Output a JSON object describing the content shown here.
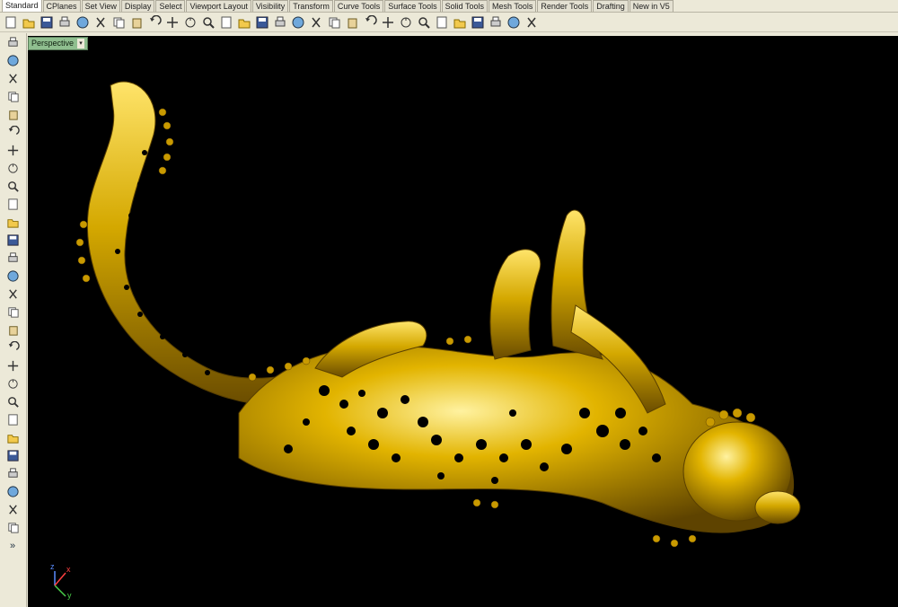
{
  "tabs": [
    "Standard",
    "CPlanes",
    "Set View",
    "Display",
    "Select",
    "Viewport Layout",
    "Visibility",
    "Transform",
    "Curve Tools",
    "Surface Tools",
    "Solid Tools",
    "Mesh Tools",
    "Render Tools",
    "Drafting",
    "New in V5"
  ],
  "active_tab": "Standard",
  "viewport": {
    "title": "Perspective",
    "dropdown_glyph": "▾"
  },
  "axis": {
    "x": "x",
    "y": "y",
    "z": "z"
  },
  "colors": {
    "gold": "#d4a800",
    "gold_light": "#ffe46a",
    "gold_dark": "#7a5a00",
    "viewport_bg": "#000000"
  },
  "toolbar_icons": [
    "new-icon",
    "open-icon",
    "save-icon",
    "print-icon",
    "import-icon",
    "cut-icon",
    "copy-icon",
    "paste-icon",
    "undo-icon",
    "pan-icon",
    "rotate-icon",
    "zoom-icon",
    "zoom-window-icon",
    "zoom-extents-icon",
    "zoom-selected-icon",
    "rotate-view-icon",
    "four-view-icon",
    "car-icon",
    "point-icon",
    "grid-icon",
    "light-icon",
    "lock-icon",
    "layer-icon",
    "color-wheel-icon",
    "material-icon",
    "sphere-icon",
    "render-icon",
    "osnap-icon",
    "gumball-icon",
    "help-icon"
  ],
  "side_icons": [
    "select-icon",
    "point-icon",
    "polyline-icon",
    "curve-icon",
    "circle-icon",
    "ellipse-icon",
    "polygon-icon",
    "rectangle-icon",
    "arc-icon",
    "fillet-icon",
    "surface-icon",
    "extrude-icon",
    "box-icon",
    "sphere-icon",
    "cylinder-icon",
    "plane-icon",
    "boolean-icon",
    "explode-icon",
    "trim-icon",
    "join-icon",
    "move-icon",
    "rotate-icon",
    "scale-icon",
    "array-icon",
    "dimension-icon",
    "text-icon",
    "group-icon",
    "mirror-icon",
    "more-icon"
  ],
  "side_more": "»"
}
